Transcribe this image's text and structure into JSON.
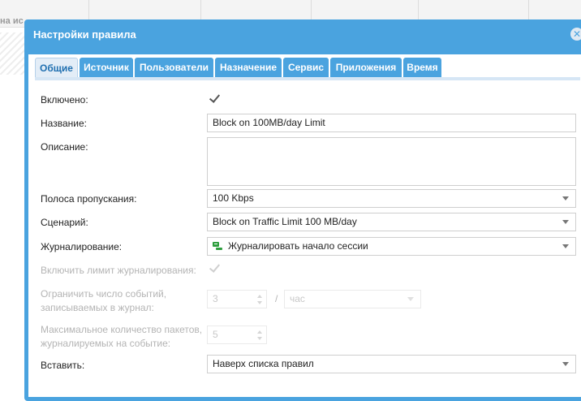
{
  "background": {
    "header_cell_text": "на ис"
  },
  "dialog": {
    "title": "Настройки правила",
    "close_icon": "close-icon"
  },
  "tabs": [
    {
      "label": "Общие",
      "active": true
    },
    {
      "label": "Источник",
      "active": false
    },
    {
      "label": "Пользователи",
      "active": false
    },
    {
      "label": "Назначение",
      "active": false
    },
    {
      "label": "Сервис",
      "active": false
    },
    {
      "label": "Приложения",
      "active": false
    },
    {
      "label": "Время",
      "active": false
    }
  ],
  "form": {
    "enabled": {
      "label": "Включено:",
      "checked": true
    },
    "name": {
      "label": "Название:",
      "value": "Block on 100MB/day Limit"
    },
    "description": {
      "label": "Описание:",
      "value": ""
    },
    "bandwidth": {
      "label": "Полоса пропускания:",
      "value": "100 Kbps"
    },
    "scenario": {
      "label": "Сценарий:",
      "value": "Block on Traffic Limit 100 MB/day"
    },
    "logging": {
      "label": "Журналирование:",
      "value": "Журналировать начало сессии",
      "icon": "log-icon"
    },
    "logging_limit": {
      "label": "Включить лимит журналирования:",
      "checked": true,
      "disabled": true
    },
    "limit_events": {
      "label_line1": "Ограничить число событий,",
      "label_line2": "записываемых в журнал:",
      "value": "3",
      "separator": "/",
      "unit": "час",
      "disabled": true
    },
    "max_packets": {
      "label_line1": "Максимальное количество пакетов,",
      "label_line2": "журналируемых на событие:",
      "value": "5",
      "disabled": true
    },
    "insert": {
      "label": "Вставить:",
      "value": "Наверх списка правил"
    }
  },
  "colors": {
    "accent": "#4aa3df",
    "tab_active_text": "#1f6fb0",
    "log_icon": "#2e9e3e"
  }
}
